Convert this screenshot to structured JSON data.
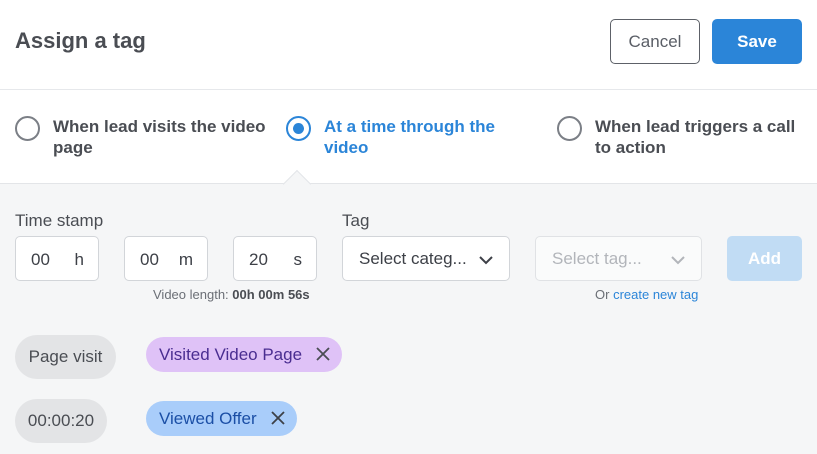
{
  "header": {
    "title": "Assign a tag",
    "cancel_label": "Cancel",
    "save_label": "Save"
  },
  "trigger_options": [
    {
      "label": "When lead visits the video page",
      "selected": false
    },
    {
      "label": "At a time through the video",
      "selected": true
    },
    {
      "label": "When lead triggers a call to action",
      "selected": false
    }
  ],
  "timestamp": {
    "label": "Time stamp",
    "hours": "00",
    "hours_unit": "h",
    "minutes": "00",
    "minutes_unit": "m",
    "seconds": "20",
    "seconds_unit": "s",
    "video_length_prefix": "Video length:",
    "video_length_value": "00h 00m 56s"
  },
  "tag": {
    "label": "Tag",
    "category_placeholder": "Select categ...",
    "tag_placeholder": "Select tag...",
    "add_label": "Add",
    "create_prefix": "Or",
    "create_link": "create new tag"
  },
  "assigned": [
    {
      "trigger": "Page visit",
      "tag": "Visited Video Page",
      "tag_color": "#dfc2f7"
    },
    {
      "trigger": "00:00:20",
      "tag": "Viewed Offer",
      "tag_color": "#a9cdfa"
    }
  ],
  "colors": {
    "accent": "#2b85d8",
    "panel_bg": "#f5f6f7"
  }
}
